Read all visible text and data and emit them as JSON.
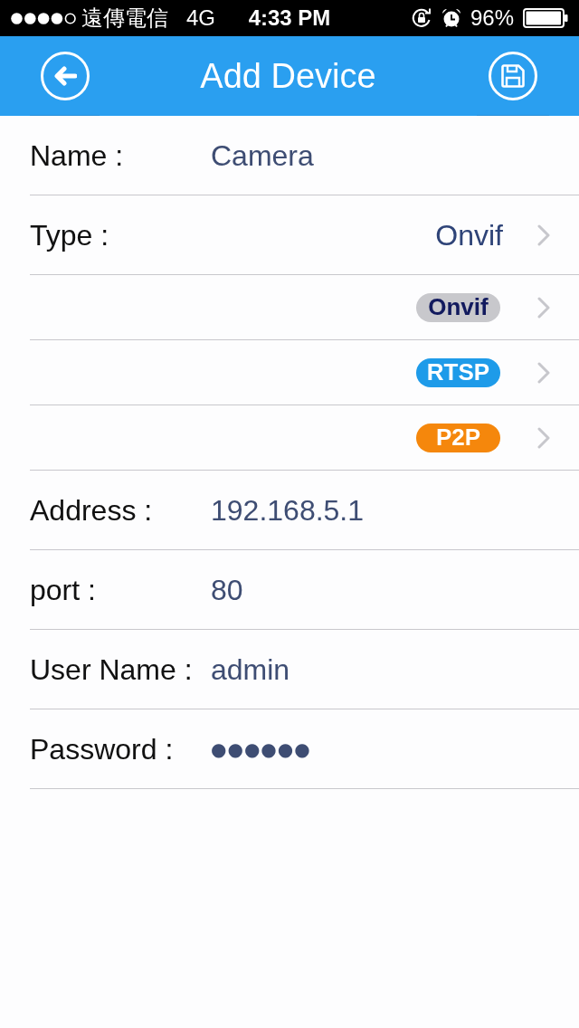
{
  "status_bar": {
    "carrier": "遠傳電信",
    "network": "4G",
    "time": "4:33 PM",
    "battery": "96%"
  },
  "nav_bar": {
    "title": "Add Device"
  },
  "form": {
    "rows": [
      {
        "kind": "field",
        "label": "Name :",
        "value": "Camera"
      },
      {
        "kind": "select",
        "label": "Type :",
        "value": "Onvif"
      },
      {
        "kind": "option",
        "text": "Onvif",
        "color": "#c8c8cc",
        "selected": true
      },
      {
        "kind": "option",
        "text": "RTSP",
        "color": "#1e9be9",
        "selected": false
      },
      {
        "kind": "option",
        "text": "P2P",
        "color": "#f5870c",
        "selected": false
      },
      {
        "kind": "field",
        "label": "Address :",
        "value": "192.168.5.1"
      },
      {
        "kind": "field",
        "label": "port :",
        "value": "80"
      },
      {
        "kind": "field",
        "label": "User Name :",
        "value": "admin"
      },
      {
        "kind": "password",
        "label": "Password :",
        "value": "●●●●●●"
      }
    ]
  }
}
